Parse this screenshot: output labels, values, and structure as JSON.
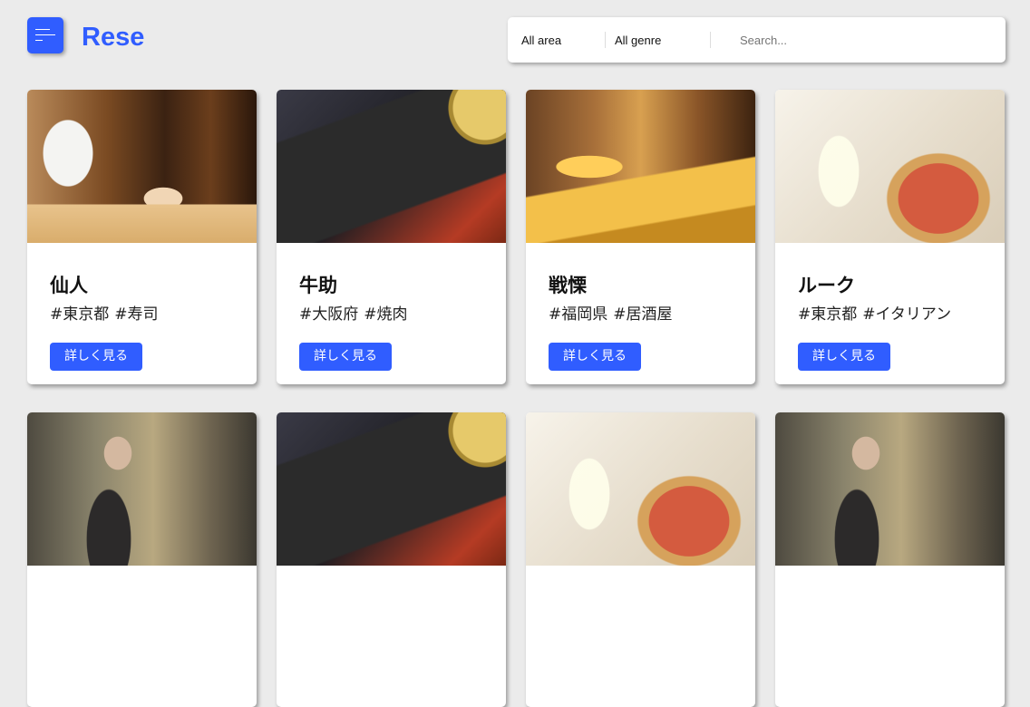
{
  "header": {
    "logo": "Rese",
    "search": {
      "area_value": "All area",
      "genre_value": "All genre",
      "placeholder": "Search..."
    }
  },
  "cards": [
    {
      "name": "仙人",
      "tags": [
        "#東京都",
        "#寿司"
      ],
      "button": "詳しく見る",
      "image": "sushi-chef-photo"
    },
    {
      "name": "牛助",
      "tags": [
        "#大阪府",
        "#焼肉"
      ],
      "button": "詳しく見る",
      "image": "yakiniku-beef-photo"
    },
    {
      "name": "戦慄",
      "tags": [
        "#福岡県",
        "#居酒屋"
      ],
      "button": "詳しく見る",
      "image": "izakaya-interior-photo"
    },
    {
      "name": "ルーク",
      "tags": [
        "#東京都",
        "#イタリアン"
      ],
      "button": "詳しく見る",
      "image": "pizza-wine-photo"
    },
    {
      "image": "kitchen-chef-photo"
    },
    {
      "image": "yakiniku-beef-photo"
    },
    {
      "image": "pizza-wine-photo"
    },
    {
      "image": "kitchen-chef-photo"
    }
  ]
}
